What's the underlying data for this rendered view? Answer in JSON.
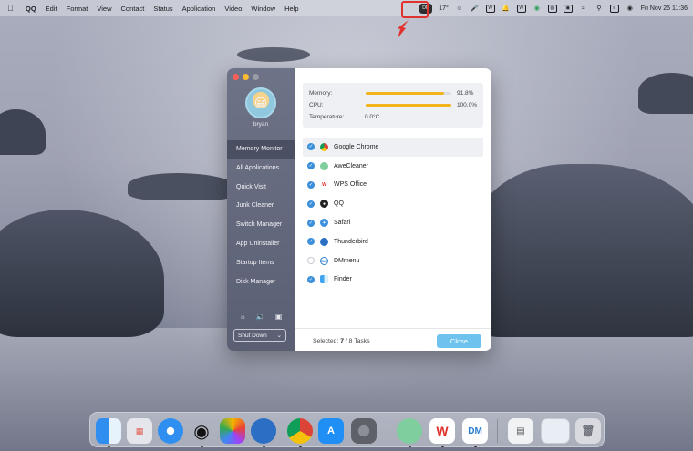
{
  "menubar": {
    "apple_icon": "apple-icon",
    "app_name": "QQ",
    "items": [
      "Edit",
      "Format",
      "View",
      "Contact",
      "Status",
      "Application",
      "Video",
      "Window",
      "Help"
    ],
    "status_temp": "17°",
    "clock": "Fri Nov 25  11:36",
    "dm_label": "DM",
    "highlight_color": "#e0332f"
  },
  "window": {
    "username": "bryan",
    "nav": [
      "Memory Monitor",
      "All Applications",
      "Quick Visit",
      "Junk Cleaner",
      "Switch Manager",
      "App Uninstaller",
      "Startup Items",
      "Disk Manager"
    ],
    "shutdown_label": "Shut Down",
    "stats": {
      "memory_label": "Memory:",
      "memory_value": "91.8%",
      "memory_fraction": 0.918,
      "cpu_label": "CPU:",
      "cpu_value": "100.0%",
      "cpu_fraction": 1.0,
      "temp_label": "Temperature:",
      "temp_value": "0.0°C",
      "bar_color": "#f2b31c"
    },
    "apps": [
      {
        "name": "Google Chrome",
        "checked": true
      },
      {
        "name": "AweCleaner",
        "checked": true
      },
      {
        "name": "WPS Office",
        "checked": true
      },
      {
        "name": "QQ",
        "checked": true
      },
      {
        "name": "Safari",
        "checked": true
      },
      {
        "name": "Thunderbird",
        "checked": true
      },
      {
        "name": "DMmenu",
        "checked": false
      },
      {
        "name": "Finder",
        "checked": true
      }
    ],
    "footer": {
      "selected_prefix": "Selected: ",
      "selected_count": "7",
      "selected_suffix": " / 8 Tasks",
      "close_label": "Close"
    }
  },
  "dock": {
    "apps": [
      "Finder",
      "Launchpad",
      "Safari",
      "QQ",
      "Photos",
      "Thunderbird",
      "Google Chrome",
      "App Store",
      "System Preferences",
      "AweCleaner",
      "WPS Office",
      "DMmenu",
      "Preview",
      "Finder Window",
      "Trash"
    ],
    "dm_label": "DM"
  }
}
